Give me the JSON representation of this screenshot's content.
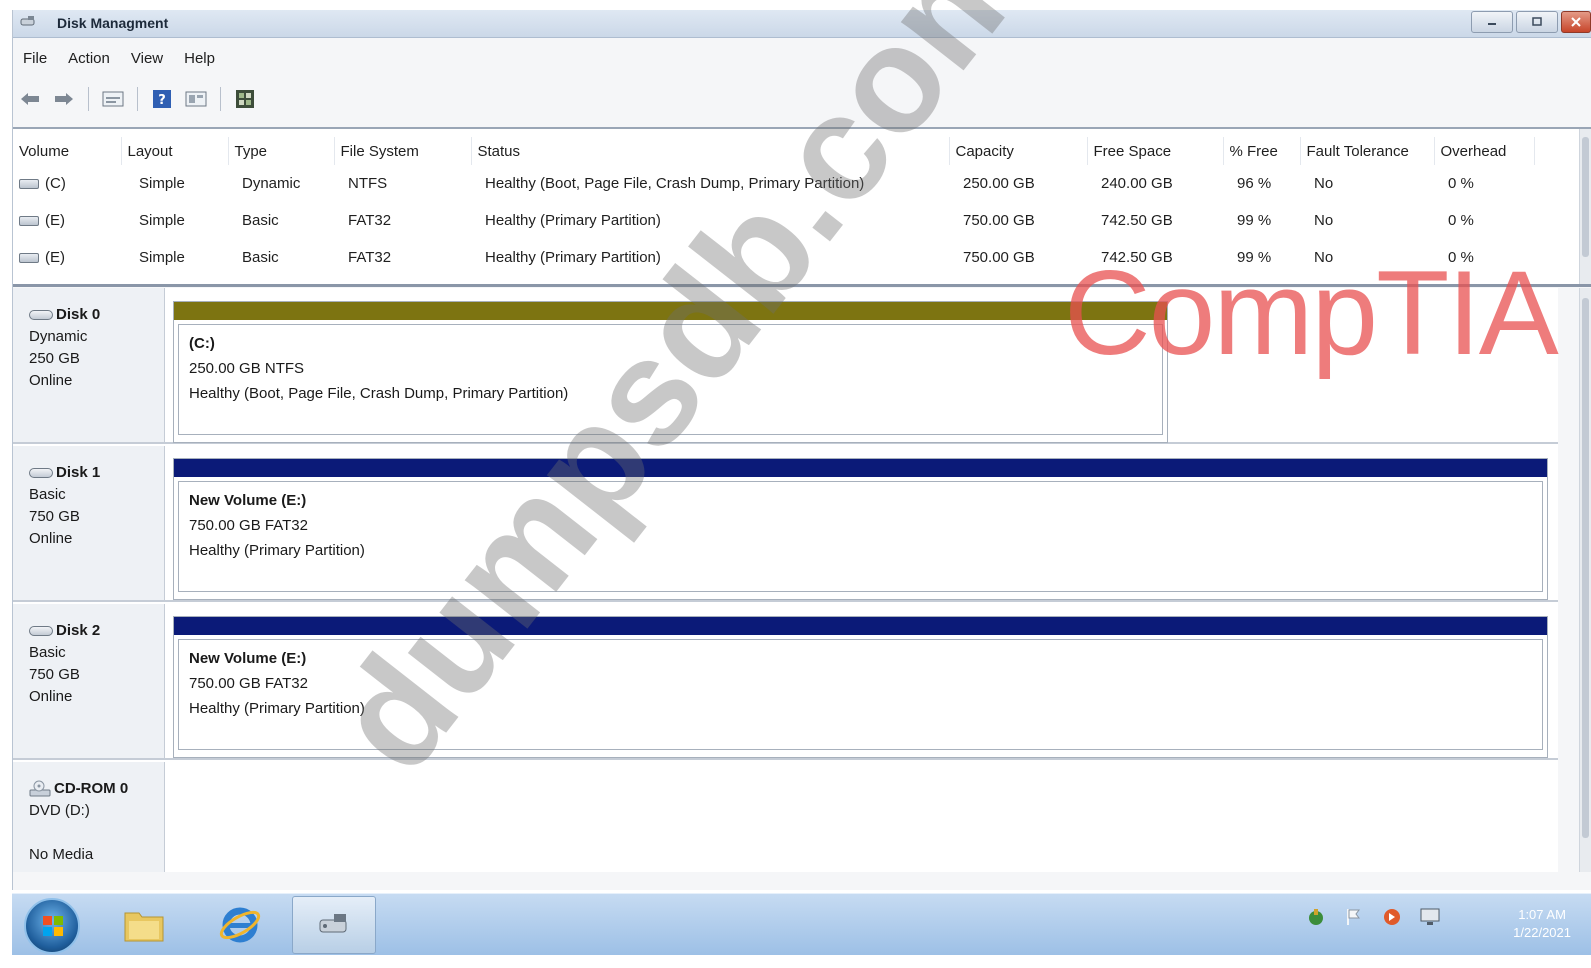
{
  "window": {
    "title": "Disk Managment"
  },
  "menu": [
    "File",
    "Action",
    "View",
    "Help"
  ],
  "toolbar": [
    "back-icon",
    "forward-icon",
    "properties-icon",
    "help-icon",
    "view-icon",
    "console-icon"
  ],
  "volume_list": {
    "columns": [
      "Volume",
      "Layout",
      "Type",
      "File System",
      "Status",
      "Capacity",
      "Free Space",
      "% Free",
      "Fault Tolerance",
      "Overhead"
    ],
    "rows": [
      [
        "(C)",
        "Simple",
        "Dynamic",
        "NTFS",
        "Healthy (Boot, Page File, Crash Dump, Primary Partition)",
        "250.00 GB",
        "240.00 GB",
        "96 %",
        "No",
        "0 %"
      ],
      [
        "(E)",
        "Simple",
        "Basic",
        "FAT32",
        "Healthy (Primary Partition)",
        "750.00 GB",
        "742.50 GB",
        "99 %",
        "No",
        "0 %"
      ],
      [
        "(E)",
        "Simple",
        "Basic",
        "FAT32",
        "Healthy (Primary Partition)",
        "750.00 GB",
        "742.50 GB",
        "99 %",
        "No",
        "0 %"
      ]
    ]
  },
  "disks": [
    {
      "name": "Disk 0",
      "kind": "Dynamic",
      "size": "250 GB",
      "state": "Online",
      "volume": "(C:)",
      "detail": "250.00 GB  NTFS",
      "status": "Healthy (Boot, Page File, Crash Dump, Primary Partition)",
      "bar_color": "#7d7411"
    },
    {
      "name": "Disk 1",
      "kind": "Basic",
      "size": "750 GB",
      "state": "Online",
      "volume": "New Volume (E:)",
      "detail": "750.00 GB  FAT32",
      "status": "Healthy (Primary Partition)",
      "bar_color": "#0b1a78"
    },
    {
      "name": "Disk 2",
      "kind": "Basic",
      "size": "750 GB",
      "state": "Online",
      "volume": "New Volume (E:)",
      "detail": "750.00 GB  FAT32",
      "status": "Healthy (Primary Partition)",
      "bar_color": "#0b1a78"
    }
  ],
  "cdrom": {
    "name": "CD-ROM 0",
    "type": "DVD (D:)",
    "state": "No Media"
  },
  "watermark": "dumpsdb.com",
  "brand": "CompTIA",
  "taskbar": {
    "items": [
      "start-button",
      "explorer-icon",
      "internet-explorer-icon",
      "disk-management-icon"
    ],
    "tray": [
      "network-icon",
      "action-center-icon",
      "update-icon",
      "display-icon"
    ],
    "clock_time": "1:07 AM",
    "clock_date": "1/22/2021"
  }
}
